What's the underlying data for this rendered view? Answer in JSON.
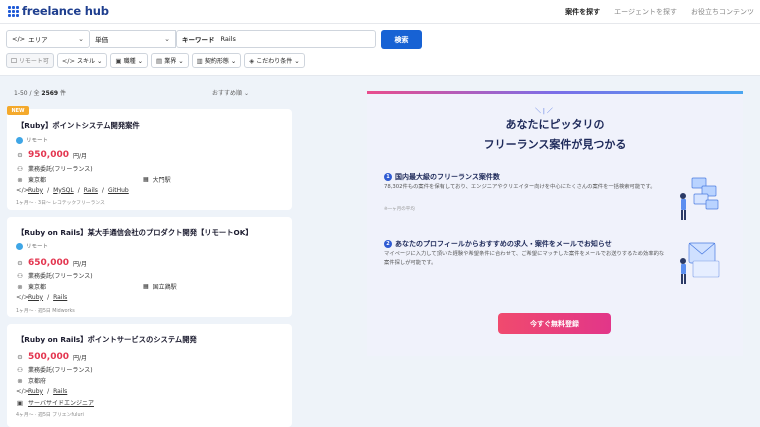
{
  "header": {
    "logo_text": "freelance hub",
    "nav": [
      "案件を探す",
      "エージェントを探す",
      "お役立ちコンテンツ"
    ]
  },
  "search": {
    "area_label": "エリア",
    "age_label": "単価",
    "keyword_label": "キーワード",
    "keyword_value": "Rails",
    "search_button": "検索",
    "chips": [
      "リモート可",
      "スキル",
      "職種",
      "業界",
      "契約形態",
      "こだわり条件"
    ]
  },
  "list": {
    "count_prefix": "1-50 / 全",
    "count_total": "2569",
    "count_suffix": "件",
    "sort_label": "おすすめ順",
    "new_badge": "NEW"
  },
  "jobs": [
    {
      "title": "【Ruby】ポイントシステム開発案件",
      "remote": "リモート",
      "price": "950,000",
      "unit": "円/月",
      "contract": "業務委託(フリーランス)",
      "location": "東京都",
      "station": "大門駅",
      "skills": [
        "Ruby",
        "MySQL",
        "Rails",
        "GitHub"
      ],
      "meta": "1ヶ月〜 · 3日〜 レコテックフリーランス"
    },
    {
      "title": "【Ruby on Rails】某大手通信会社のプロダクト開発【リモートOK】",
      "remote": "リモート",
      "price": "650,000",
      "unit": "円/月",
      "contract": "業務委託(フリーランス)",
      "location": "東京都",
      "station": "国立鶏駅",
      "skills": [
        "Ruby",
        "Rails"
      ],
      "meta": "1ヶ月〜 · 週5日 Midworks"
    },
    {
      "title": "【Ruby on Rails】ポイントサービスのシステム開発",
      "remote": "",
      "price": "500,000",
      "unit": "円/月",
      "contract": "業務委託(フリーランス)",
      "location": "京都府",
      "station": "",
      "skills": [
        "Ruby",
        "Rails"
      ],
      "role": "サーバサイドエンジニア",
      "meta": "4ヶ月〜 · 週5日 ブリエンfuluri"
    }
  ],
  "promo": {
    "headline_pre": "あなたに",
    "headline_em": "ピッタリ",
    "headline_post": "の",
    "headline_line2": "フリーランス案件が見つかる",
    "feature1_num": "1",
    "feature1_title": "国内最大級のフリーランス案件数",
    "feature1_desc": "78,302件もの案件を保有しており、エンジニアやクリエイター向けを中心にたくさんの案件を一括検索可能です。",
    "feature1_note": "※一ヶ月の平均",
    "feature2_num": "2",
    "feature2_title": "あなたのプロフィールからおすすめの求人・案件をメールでお知らせ",
    "feature2_desc": "マイページに入力して頂いた経験や希望条件に合わせて、ご希望にマッチした案件をメールでお送りするため効率的な案件探しが可能です。",
    "cta": "今すぐ無料登録"
  },
  "colors": {
    "primary": "#1762d4",
    "price": "#e3354f",
    "cta": "#f04a6e",
    "badge": "#f4a92c"
  }
}
